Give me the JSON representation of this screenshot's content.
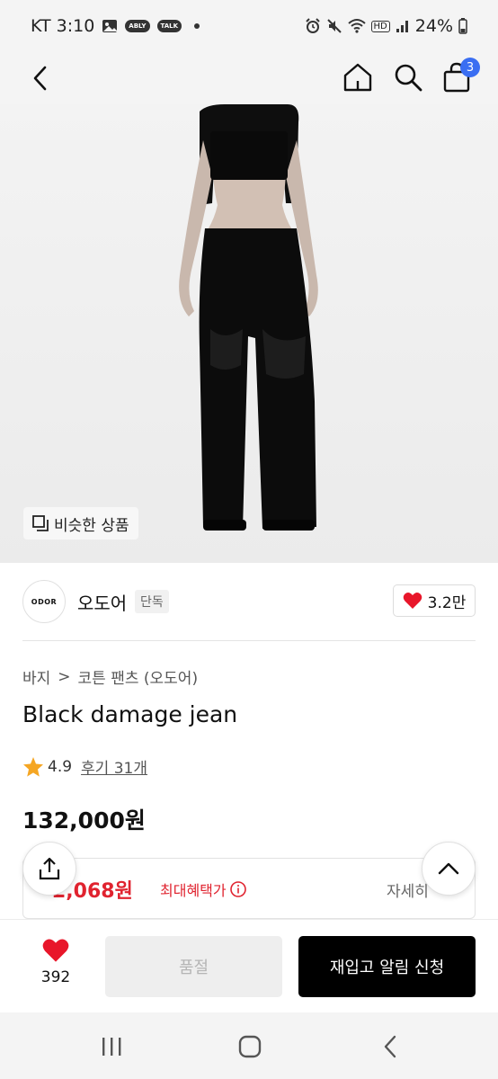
{
  "status_bar": {
    "carrier_time": "KT 3:10",
    "talk_badge": "TALK",
    "ably_badge": "ABLY",
    "battery": "24%",
    "network": "HD"
  },
  "header": {
    "cart_count": "3"
  },
  "image": {
    "similar_label": "비슷한 상품"
  },
  "brand": {
    "logo_text": "ODOR",
    "name": "오도어",
    "tag": "단독",
    "likes": "3.2만"
  },
  "breadcrumb": {
    "category": "바지",
    "separator": ">",
    "subcategory": "코튼 팬츠 (오도어)"
  },
  "product": {
    "title": "Black damage jean",
    "rating": "4.9",
    "reviews": "후기 31개",
    "price": "132,000원"
  },
  "benefit": {
    "price": "2,068원",
    "label": "최대혜택가",
    "detail": "자세히"
  },
  "bottom_bar": {
    "like_count": "392",
    "soldout_label": "품절",
    "restock_label": "재입고 알림 신청"
  },
  "colors": {
    "accent_red": "#e0232f",
    "badge_blue": "#3a6ef2",
    "heart_red": "#e8162a",
    "star": "#f5a623"
  }
}
